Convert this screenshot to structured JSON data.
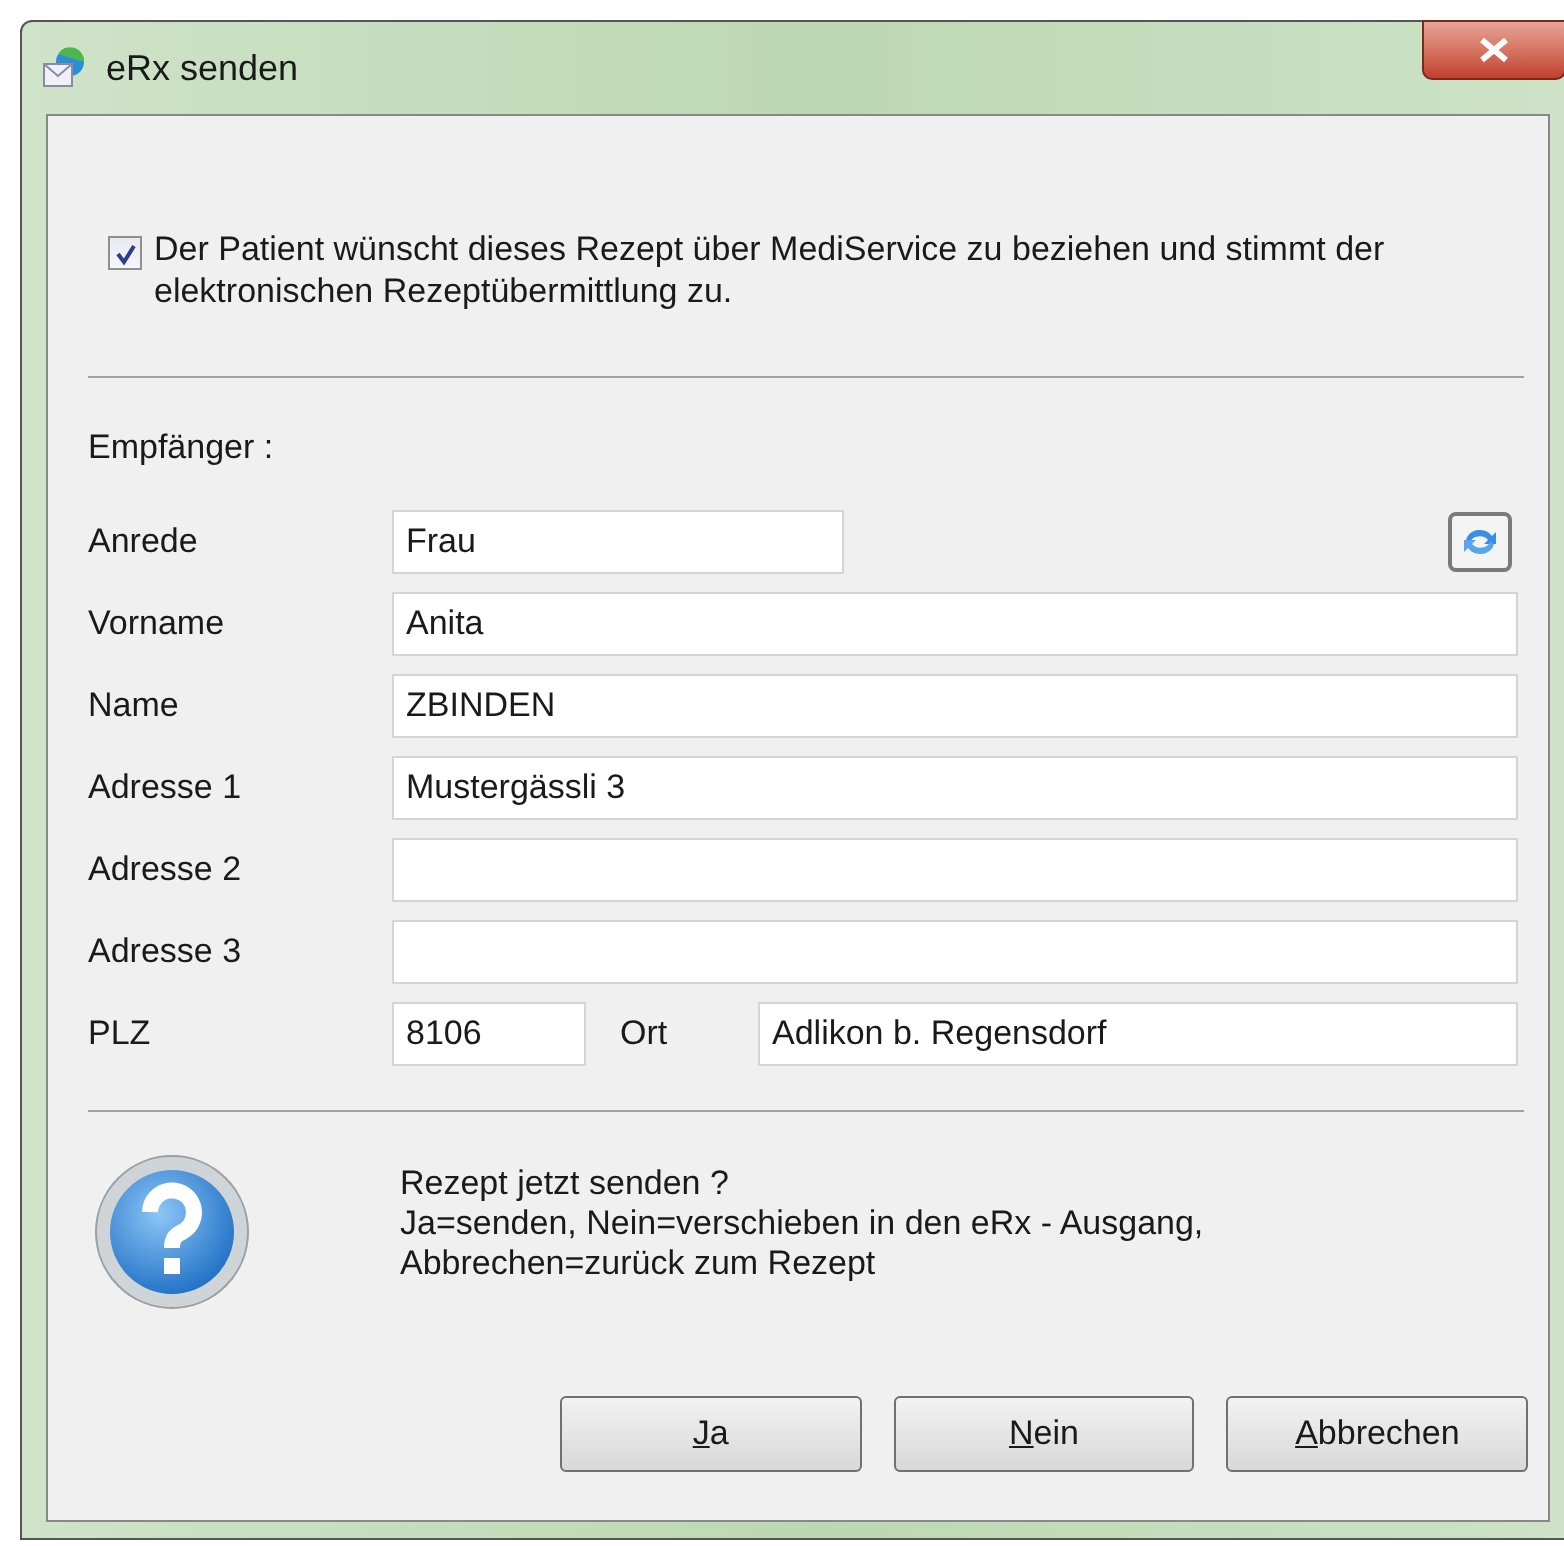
{
  "window": {
    "title": "eRx senden"
  },
  "consent": {
    "checked": true,
    "text": "Der Patient wünscht dieses Rezept über MediService zu beziehen und stimmt der elektronischen Rezeptübermittlung zu."
  },
  "recipient_heading": "Empfänger :",
  "fields": [
    {
      "label": "Anrede",
      "value": "Frau",
      "kind": "short"
    },
    {
      "label": "Vorname",
      "value": "Anita",
      "kind": "full"
    },
    {
      "label": "Name",
      "value": "ZBINDEN",
      "kind": "full"
    },
    {
      "label": "Adresse 1",
      "value": "Mustergässli 3",
      "kind": "full"
    },
    {
      "label": "Adresse 2",
      "kind": "full"
    },
    {
      "label": "Adresse 3",
      "kind": "full"
    }
  ],
  "postal": {
    "label": "PLZ",
    "value": "8106",
    "city_label": "Ort",
    "city_value": "Adlikon b. Regensdorf"
  },
  "message": [
    "Rezept jetzt senden ?",
    "Ja=senden, Nein=verschieben in den eRx - Ausgang,",
    "Abbrechen=zurück zum Rezept"
  ],
  "buttons": [
    {
      "label": "Ja",
      "mnemonic_first": true
    },
    {
      "label": "Nein",
      "mnemonic_first": true
    },
    {
      "label": "Abbrechen",
      "mnemonic_first": true
    }
  ]
}
